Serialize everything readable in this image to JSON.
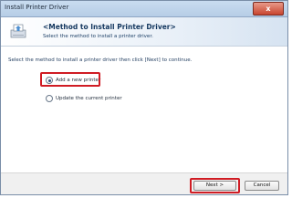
{
  "window": {
    "title": "Install Printer Driver",
    "close_glyph": "x"
  },
  "header": {
    "title": "<Method to Install Printer Driver>",
    "subtitle": "Select the method to install a printer driver.",
    "icon": "printer-driver-icon"
  },
  "content": {
    "instruction": "Select the method to install a printer driver then click [Next] to continue.",
    "options": [
      {
        "label": "Add a new printer",
        "selected": true
      },
      {
        "label": "Update the current printer",
        "selected": false
      }
    ]
  },
  "buttons": {
    "next": "Next >",
    "cancel": "Cancel"
  },
  "colors": {
    "highlight": "#d01c24",
    "header_title": "#12365e"
  }
}
